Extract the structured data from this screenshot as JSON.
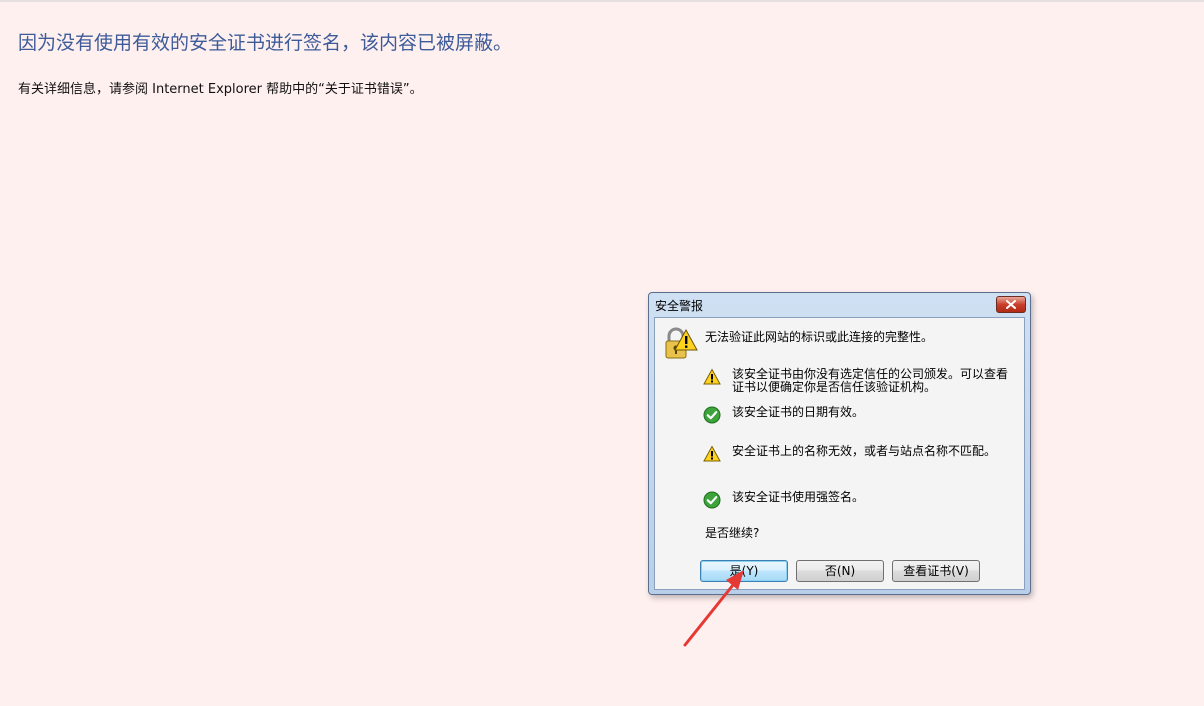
{
  "page": {
    "heading": "因为没有使用有效的安全证书进行签名，该内容已被屏蔽。",
    "detail": "有关详细信息，请参阅 Internet Explorer 帮助中的“关于证书错误”。"
  },
  "dialog": {
    "title": "安全警报",
    "main_message": "无法验证此网站的标识或此连接的完整性。",
    "items": [
      {
        "icon": "warning-icon",
        "text": "该安全证书由你没有选定信任的公司颁发。可以查看证书以便确定你是否信任该验证机构。"
      },
      {
        "icon": "check-icon",
        "text": "该安全证书的日期有效。"
      },
      {
        "icon": "warning-icon",
        "text": "安全证书上的名称无效，或者与站点名称不匹配。"
      },
      {
        "icon": "check-icon",
        "text": "该安全证书使用强签名。"
      }
    ],
    "prompt": "是否继续?",
    "buttons": {
      "yes": "是(Y)",
      "no": "否(N)",
      "view": "查看证书(V)"
    }
  },
  "colors": {
    "page_background": "#fff0f0",
    "heading": "#3d5b99",
    "annotation_arrow": "#e53935"
  }
}
